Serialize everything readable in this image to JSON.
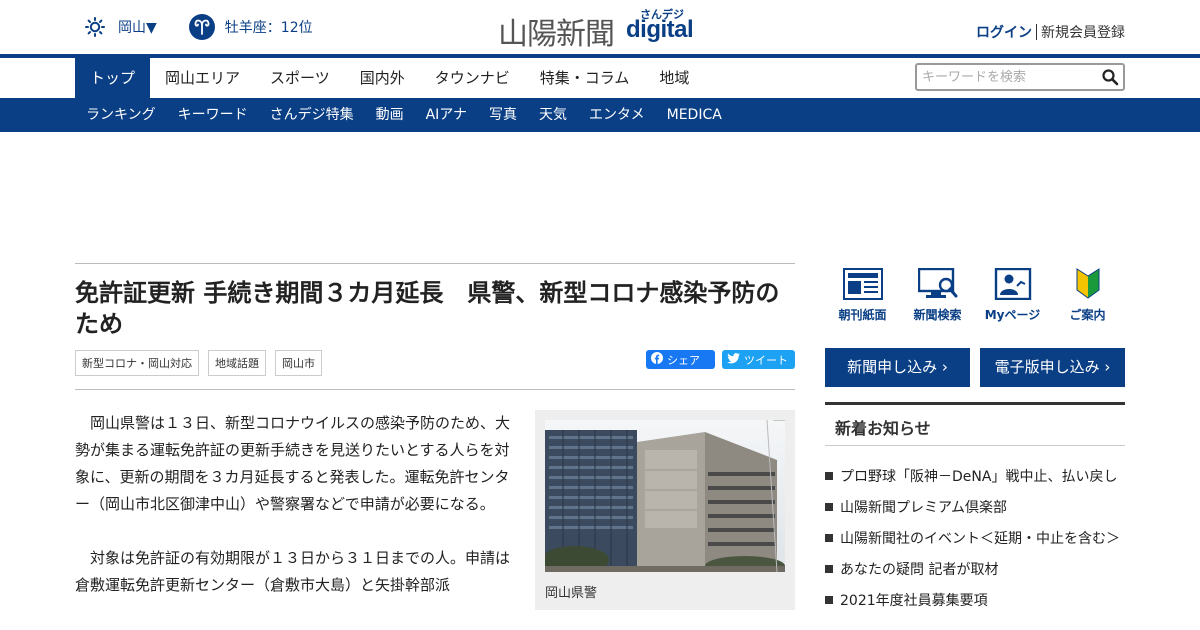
{
  "header": {
    "weather_icon": "sun-icon",
    "region": "岡山▼",
    "zodiac_icon": "aries-icon",
    "zodiac": "牡羊座：12位",
    "logo_kanji": "山陽新聞",
    "logo_sub": "さんデジ",
    "logo_digital": "digital",
    "login": "ログイン",
    "register": "新規会員登録"
  },
  "main_nav": {
    "items": [
      "トップ",
      "岡山エリア",
      "スポーツ",
      "国内外",
      "タウンナビ",
      "特集・コラム",
      "地域"
    ],
    "active_index": 0,
    "search_placeholder": "キーワードを検索"
  },
  "sub_nav": {
    "items": [
      "ランキング",
      "キーワード",
      "さんデジ特集",
      "動画",
      "AIアナ",
      "写真",
      "天気",
      "エンタメ",
      "MEDICA"
    ]
  },
  "article": {
    "headline": "免許証更新 手続き期間３カ月延長　県警、新型コロナ感染予防のため",
    "tags": [
      "新型コロナ・岡山対応",
      "地域話題",
      "岡山市"
    ],
    "share_facebook": "シェア",
    "share_twitter": "ツイート",
    "paragraphs": [
      "岡山県警は１３日、新型コロナウイルスの感染予防のため、大勢が集まる運転免許証の更新手続きを見送りたいとする人らを対象に、更新の期間を３カ月延長すると発表した。運転免許センター（岡山市北区御津中山）や警察署などで申請が必要になる。",
      "対象は免許証の有効期限が１３日から３１日までの人。申請は倉敷運転免許更新センター（倉敷市大島）と矢掛幹部派"
    ],
    "photo_caption": "岡山県警"
  },
  "sidebar": {
    "quick_links": [
      {
        "label": "朝刊紙面",
        "icon": "newspaper-icon"
      },
      {
        "label": "新聞検索",
        "icon": "monitor-search-icon"
      },
      {
        "label": "Myページ",
        "icon": "profile-icon"
      },
      {
        "label": "ご案内",
        "icon": "beginner-mark-icon"
      }
    ],
    "subscribe_paper": "新聞申し込み ›",
    "subscribe_digital": "電子版申し込み ›",
    "news_title": "新着お知らせ",
    "news_items": [
      "プロ野球「阪神－DeNA」戦中止、払い戻し",
      "山陽新聞プレミアム倶楽部",
      "山陽新聞社のイベント＜延期・中止を含む＞",
      "あなたの疑問 記者が取材",
      "2021年度社員募集要項"
    ]
  },
  "colors": {
    "brand_navy": "#0a3f86",
    "facebook": "#1877f2",
    "twitter": "#1da1f2"
  }
}
